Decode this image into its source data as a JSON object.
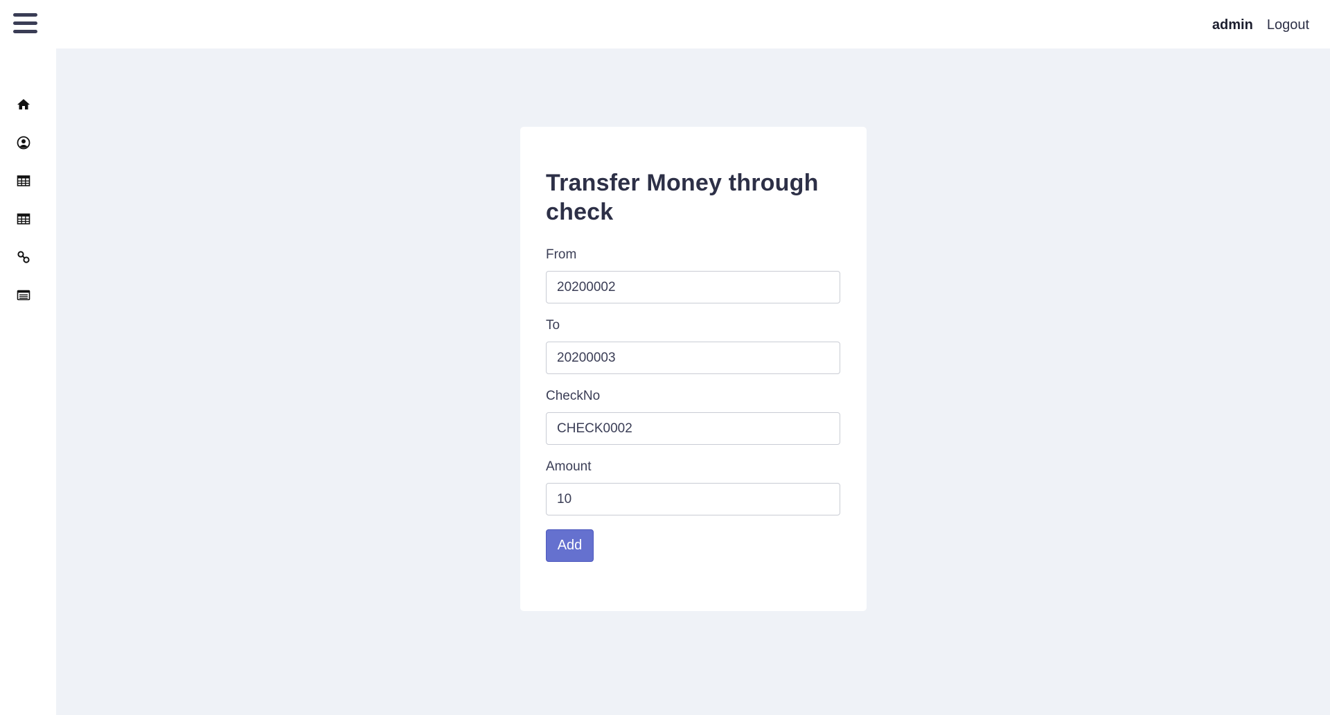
{
  "header": {
    "menu_icon": "hamburger-menu-icon",
    "username": "admin",
    "logout_label": "Logout"
  },
  "sidebar": {
    "items": [
      {
        "icon": "home-icon"
      },
      {
        "icon": "user-circle-icon"
      },
      {
        "icon": "table-icon"
      },
      {
        "icon": "table-icon"
      },
      {
        "icon": "link-icon"
      },
      {
        "icon": "list-card-icon"
      }
    ]
  },
  "form": {
    "title": "Transfer Money through check",
    "fields": [
      {
        "label": "From",
        "value": "20200002"
      },
      {
        "label": "To",
        "value": "20200003"
      },
      {
        "label": "CheckNo",
        "value": "CHECK0002"
      },
      {
        "label": "Amount",
        "value": "10"
      }
    ],
    "submit_label": "Add"
  },
  "colors": {
    "background": "#eff2f7",
    "card": "#ffffff",
    "primary_button": "#6571cf",
    "text": "#2d3047"
  }
}
